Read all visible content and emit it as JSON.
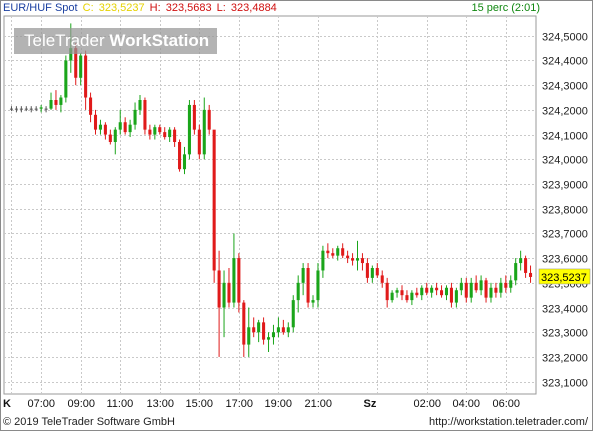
{
  "header": {
    "instrument": "EUR/HUF Spot",
    "close_label": "C:",
    "close_value": "323,5237",
    "high_label": "H:",
    "high_value": "323,5683",
    "low_label": "L:",
    "low_value": "323,4884",
    "interval": "15 perc (2:01)"
  },
  "watermark": {
    "part1": "TeleTrader",
    "part2": "WorkStation"
  },
  "footer": {
    "copyright": "© 2019 TeleTrader Software GmbH",
    "url": "http://workstation.teletrader.com/"
  },
  "colors": {
    "up": "#1aa51a",
    "down": "#e01a1a",
    "neutral": "#555555",
    "grid": "#c9c9c9",
    "last_price_bg": "#ffff00",
    "close_text": "#e6d200",
    "high_text": "#d01010",
    "low_text": "#d01010",
    "interval_text": "#118811"
  },
  "chart_data": {
    "type": "candlestick",
    "ylim": [
      323.05,
      324.58
    ],
    "y_ticks": [
      "323,1000",
      "323,2000",
      "323,3000",
      "323,4000",
      "323,5000",
      "323,6000",
      "323,7000",
      "323,8000",
      "323,9000",
      "324,0000",
      "324,1000",
      "324,2000",
      "324,3000",
      "324,4000",
      "324,5000"
    ],
    "y_tick_values": [
      323.1,
      323.2,
      323.3,
      323.4,
      323.5,
      323.6,
      323.7,
      323.8,
      323.9,
      324.0,
      324.1,
      324.2,
      324.3,
      324.4,
      324.5
    ],
    "x_ticks": [
      "K",
      "07:00",
      "09:00",
      "11:00",
      "13:00",
      "15:00",
      "17:00",
      "19:00",
      "21:00",
      "Sz",
      "02:00",
      "04:00",
      "06:00"
    ],
    "x_tick_slots": [
      0,
      6,
      14,
      22,
      30,
      38,
      46,
      54,
      62,
      74,
      84,
      92,
      100
    ],
    "x_tick_bold": [
      true,
      false,
      false,
      false,
      false,
      false,
      false,
      false,
      false,
      true,
      false,
      false,
      false
    ],
    "last_price": 323.5237,
    "last_price_label": "323,5237",
    "grid": true,
    "candles": [
      [
        324.205,
        324.215,
        324.195,
        324.205
      ],
      [
        324.205,
        324.215,
        324.19,
        324.205
      ],
      [
        324.205,
        324.215,
        324.19,
        324.205
      ],
      [
        324.205,
        324.215,
        324.195,
        324.205
      ],
      [
        324.205,
        324.215,
        324.19,
        324.205
      ],
      [
        324.205,
        324.215,
        324.195,
        324.205
      ],
      [
        324.205,
        324.22,
        324.19,
        324.21
      ],
      [
        324.205,
        324.215,
        324.19,
        324.205
      ],
      [
        324.205,
        324.27,
        324.2,
        324.24
      ],
      [
        324.24,
        324.28,
        324.2,
        324.22
      ],
      [
        324.22,
        324.26,
        324.19,
        324.25
      ],
      [
        324.25,
        324.42,
        324.23,
        324.4
      ],
      [
        324.4,
        324.55,
        324.35,
        324.45
      ],
      [
        324.45,
        324.47,
        324.3,
        324.33
      ],
      [
        324.33,
        324.43,
        324.3,
        324.42
      ],
      [
        324.42,
        324.44,
        324.2,
        324.25
      ],
      [
        324.25,
        324.27,
        324.15,
        324.18
      ],
      [
        324.18,
        324.2,
        324.1,
        324.12
      ],
      [
        324.12,
        324.16,
        324.1,
        324.14
      ],
      [
        324.14,
        324.15,
        324.08,
        324.1
      ],
      [
        324.1,
        324.12,
        324.06,
        324.07
      ],
      [
        324.07,
        324.13,
        324.02,
        324.12
      ],
      [
        324.12,
        324.2,
        324.1,
        324.15
      ],
      [
        324.15,
        324.17,
        324.1,
        324.11
      ],
      [
        324.11,
        324.16,
        324.09,
        324.14
      ],
      [
        324.14,
        324.23,
        324.12,
        324.2
      ],
      [
        324.2,
        324.26,
        324.18,
        324.24
      ],
      [
        324.24,
        324.25,
        324.1,
        324.12
      ],
      [
        324.12,
        324.14,
        324.08,
        324.1
      ],
      [
        324.1,
        324.14,
        324.08,
        324.13
      ],
      [
        324.13,
        324.14,
        324.1,
        324.11
      ],
      [
        324.11,
        324.13,
        324.08,
        324.09
      ],
      [
        324.09,
        324.13,
        324.07,
        324.12
      ],
      [
        324.12,
        324.13,
        324.05,
        324.07
      ],
      [
        324.07,
        324.08,
        323.95,
        323.96
      ],
      [
        323.96,
        324.05,
        323.94,
        324.02
      ],
      [
        324.02,
        324.24,
        324.0,
        324.22
      ],
      [
        324.22,
        324.24,
        324.1,
        324.12
      ],
      [
        324.12,
        324.14,
        324.0,
        324.02
      ],
      [
        324.02,
        324.25,
        324.0,
        324.2
      ],
      [
        324.2,
        324.22,
        324.1,
        324.12
      ],
      [
        324.12,
        323.88,
        323.5,
        323.55
      ],
      [
        323.55,
        323.63,
        323.2,
        323.4
      ],
      [
        323.4,
        323.55,
        323.28,
        323.5
      ],
      [
        323.5,
        323.56,
        323.4,
        323.42
      ],
      [
        323.42,
        323.7,
        323.4,
        323.6
      ],
      [
        323.6,
        323.62,
        323.38,
        323.42
      ],
      [
        323.42,
        323.43,
        323.2,
        323.25
      ],
      [
        323.25,
        323.4,
        323.2,
        323.32
      ],
      [
        323.32,
        323.36,
        323.28,
        323.3
      ],
      [
        323.3,
        323.35,
        323.26,
        323.34
      ],
      [
        323.34,
        323.36,
        323.25,
        323.27
      ],
      [
        323.27,
        323.3,
        323.22,
        323.28
      ],
      [
        323.28,
        323.33,
        323.25,
        323.3
      ],
      [
        323.3,
        323.36,
        323.28,
        323.32
      ],
      [
        323.32,
        323.35,
        323.29,
        323.3
      ],
      [
        323.3,
        323.34,
        323.28,
        323.32
      ],
      [
        323.32,
        323.45,
        323.3,
        323.43
      ],
      [
        323.43,
        323.53,
        323.38,
        323.5
      ],
      [
        323.5,
        323.58,
        323.45,
        323.56
      ],
      [
        323.56,
        323.58,
        323.4,
        323.42
      ],
      [
        323.42,
        323.45,
        323.4,
        323.43
      ],
      [
        323.43,
        323.58,
        323.4,
        323.55
      ],
      [
        323.55,
        323.65,
        323.52,
        323.63
      ],
      [
        323.63,
        323.66,
        323.6,
        323.62
      ],
      [
        323.62,
        323.64,
        323.6,
        323.61
      ],
      [
        323.61,
        323.65,
        323.59,
        323.64
      ],
      [
        323.64,
        323.66,
        323.6,
        323.61
      ],
      [
        323.61,
        323.63,
        323.58,
        323.6
      ],
      [
        323.6,
        323.62,
        323.57,
        323.59
      ],
      [
        323.59,
        323.67,
        323.55,
        323.6
      ],
      [
        323.6,
        323.62,
        323.55,
        323.58
      ],
      [
        323.58,
        323.6,
        323.5,
        323.52
      ],
      [
        323.52,
        323.57,
        323.5,
        323.56
      ],
      [
        323.56,
        323.58,
        323.52,
        323.53
      ],
      [
        323.53,
        323.55,
        323.48,
        323.5
      ],
      [
        323.5,
        323.52,
        323.4,
        323.43
      ],
      [
        323.43,
        323.47,
        323.42,
        323.46
      ],
      [
        323.46,
        323.48,
        323.44,
        323.47
      ],
      [
        323.47,
        323.49,
        323.43,
        323.45
      ],
      [
        323.45,
        323.47,
        323.42,
        323.43
      ],
      [
        323.43,
        323.47,
        323.41,
        323.46
      ],
      [
        323.46,
        323.48,
        323.44,
        323.45
      ],
      [
        323.45,
        323.49,
        323.43,
        323.48
      ],
      [
        323.48,
        323.5,
        323.45,
        323.46
      ],
      [
        323.46,
        323.49,
        323.44,
        323.48
      ],
      [
        323.48,
        323.5,
        323.45,
        323.47
      ],
      [
        323.47,
        323.49,
        323.44,
        323.45
      ],
      [
        323.45,
        323.49,
        323.43,
        323.48
      ],
      [
        323.48,
        323.5,
        323.4,
        323.42
      ],
      [
        323.42,
        323.48,
        323.4,
        323.47
      ],
      [
        323.47,
        323.52,
        323.45,
        323.5
      ],
      [
        323.5,
        323.52,
        323.42,
        323.44
      ],
      [
        323.44,
        323.52,
        323.42,
        323.5
      ],
      [
        323.5,
        323.53,
        323.46,
        323.47
      ],
      [
        323.47,
        323.53,
        323.45,
        323.51
      ],
      [
        323.51,
        323.52,
        323.42,
        323.44
      ],
      [
        323.44,
        323.5,
        323.42,
        323.48
      ],
      [
        323.48,
        323.5,
        323.44,
        323.46
      ],
      [
        323.46,
        323.52,
        323.44,
        323.5
      ],
      [
        323.5,
        323.53,
        323.46,
        323.48
      ],
      [
        323.48,
        323.53,
        323.46,
        323.51
      ],
      [
        323.51,
        323.6,
        323.49,
        323.58
      ],
      [
        323.58,
        323.63,
        323.55,
        323.6
      ],
      [
        323.6,
        323.61,
        323.52,
        323.54
      ],
      [
        323.54,
        323.57,
        323.5,
        323.5237
      ]
    ]
  }
}
